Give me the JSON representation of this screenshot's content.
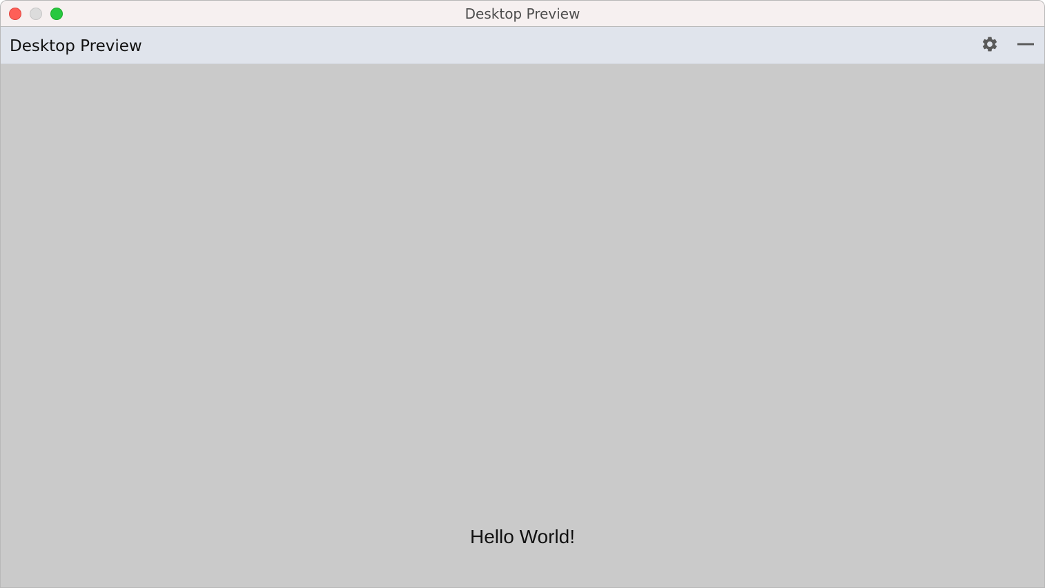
{
  "window": {
    "title": "Desktop Preview",
    "controls": {
      "close_icon": "close-dot",
      "minimize_icon": "minimize-dot",
      "zoom_icon": "zoom-dot",
      "close_color": "#fe5f57",
      "minimize_color": "#dcdcdc",
      "zoom_color": "#28c840"
    }
  },
  "appbar": {
    "title": "Desktop Preview",
    "settings_icon": "gear-icon",
    "minimize_icon": "minus-icon",
    "background": "#e0e4ec"
  },
  "content": {
    "message": "Hello World!",
    "background": "#cacaca"
  }
}
